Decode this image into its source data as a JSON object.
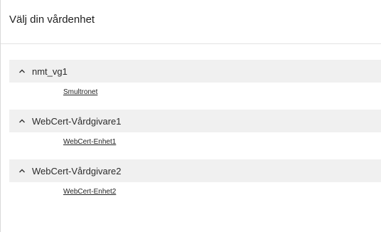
{
  "header": {
    "title": "Välj din vårdenhet"
  },
  "groups": [
    {
      "label": "nmt_vg1",
      "units": [
        "Smultronet"
      ]
    },
    {
      "label": "WebCert-Vårdgivare1",
      "units": [
        "WebCert-Enhet1"
      ]
    },
    {
      "label": "WebCert-Vårdgivare2",
      "units": [
        "WebCert-Enhet2"
      ]
    }
  ],
  "icons": {
    "group_toggle": "chevron-up-icon"
  },
  "colors": {
    "group_header_bg": "#f0f0f0",
    "text": "#2b2b2b"
  }
}
